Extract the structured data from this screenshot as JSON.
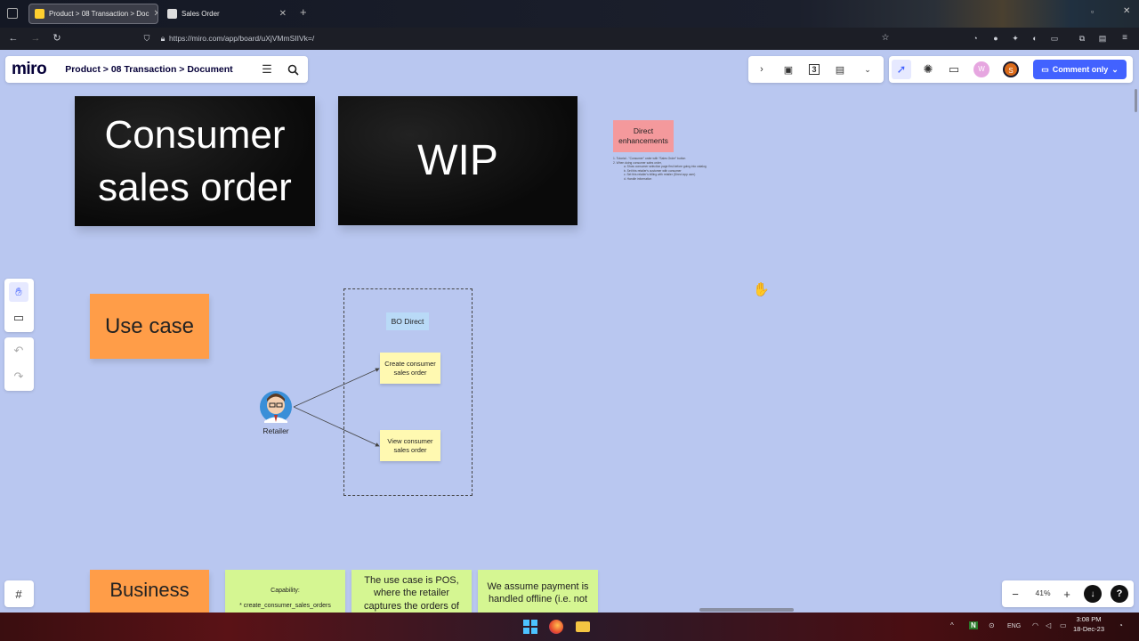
{
  "browser": {
    "tabs": [
      {
        "title": "Product > 08 Transaction > Doc",
        "active": true
      },
      {
        "title": "Sales Order",
        "active": false
      }
    ],
    "url": "https://miro.com/app/board/uXjVMmSIIVk=/"
  },
  "miro": {
    "logo": "miro",
    "board_title": "Product > 08 Transaction > Document",
    "frames_count": "3",
    "comment_only_label": "Comment only",
    "avatars": [
      {
        "letter": "W",
        "color": "#e6a6e0"
      },
      {
        "letter": "S",
        "color": "#d96a1a"
      }
    ],
    "zoom": "41%"
  },
  "canvas": {
    "consumer_card": "Consumer sales order",
    "wip_card": "WIP",
    "direct_enhancements": "Direct enhancements",
    "notes": [
      "1. Tutorial - \"Consumer\" order with \"Sales Order\" button",
      "2. When doing consumer sales order,",
      "a. Show consumer selection page first before going into catalog",
      "b. Set this retailer's customer with consumer",
      "c. Set this retailer's billing with retailer (Direct app user)",
      "d. Handle information"
    ],
    "use_case": "Use case",
    "bo_direct": "BO Direct",
    "create_consumer_sales_order": "Create consumer sales order",
    "view_consumer_sales_order": "View consumer sales order",
    "retailer": "Retailer",
    "business": "Business",
    "capability_title": "Capability:",
    "capability_item": "* create_consumer_sales_orders",
    "pos_note": "The use case is POS, where the retailer captures the orders of",
    "payment_note": "We assume payment is handled offline (i.e. not"
  },
  "taskbar": {
    "lang": "ENG",
    "time": "3:08 PM",
    "date": "18-Dec-23"
  }
}
